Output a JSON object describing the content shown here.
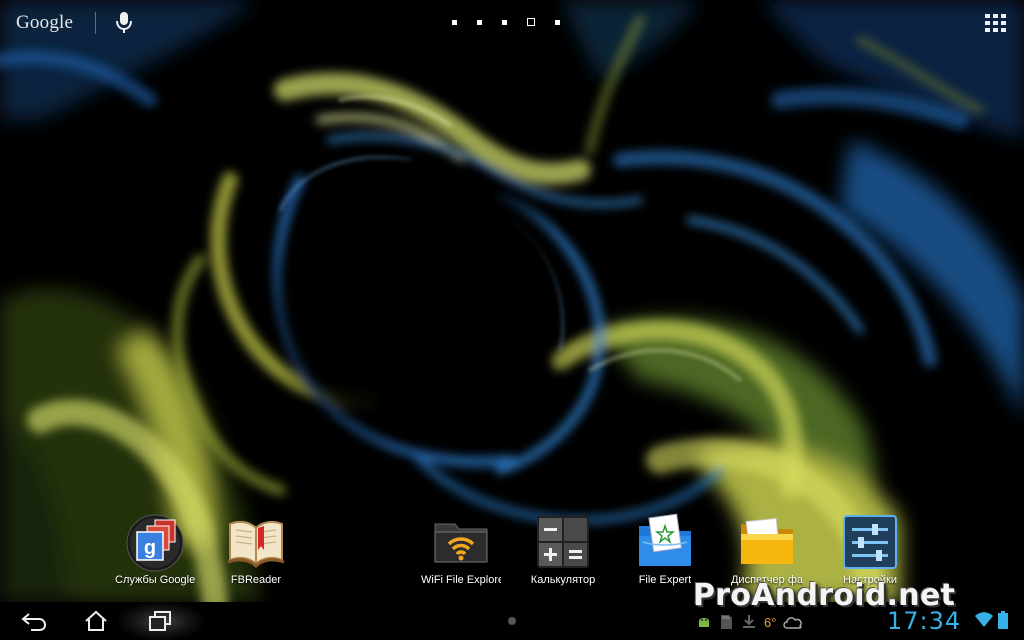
{
  "top_bar": {
    "search_label": "Google",
    "mic_icon": "microphone-icon",
    "pages": {
      "count": 5,
      "current": 4
    },
    "apps_icon": "all-apps-grid-icon"
  },
  "shortcuts": [
    {
      "label": "Службы Google",
      "icon": "google-services-icon"
    },
    {
      "label": "FBReader",
      "icon": "book-icon"
    },
    {
      "label": "WiFi File Explore",
      "icon": "wifi-folder-icon"
    },
    {
      "label": "Калькулятор",
      "icon": "calculator-icon"
    },
    {
      "label": "File Expert",
      "icon": "file-expert-icon"
    },
    {
      "label": "Диспетчер фа",
      "icon": "file-manager-folder-icon"
    },
    {
      "label": "Настройки",
      "icon": "settings-sliders-icon"
    }
  ],
  "nav": {
    "back_icon": "back-icon",
    "home_icon": "home-icon",
    "recent_icon": "recent-apps-icon"
  },
  "status": {
    "watermark": "ProAndroid.net",
    "temperature": "6°",
    "time": "17:34",
    "wifi_icon": "wifi-icon",
    "battery_icon": "battery-icon"
  },
  "colors": {
    "clock": "#38b0e8",
    "wallpaper_yellow": "#d8e060",
    "wallpaper_blue": "#2a78c8"
  }
}
